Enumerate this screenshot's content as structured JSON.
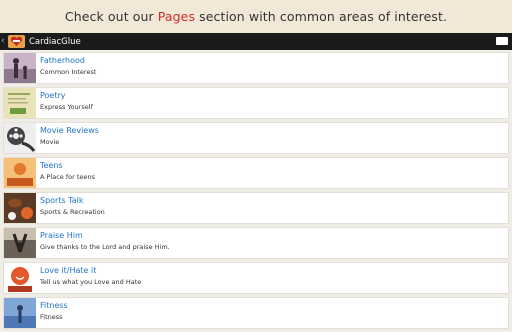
{
  "banner": {
    "pre": "Check out our",
    "highlight": "Pages",
    "post": "section with common areas of interest."
  },
  "app": {
    "title": "CardiacGlue",
    "back_icon": "back-chevron-icon",
    "logo_icon": "heart-logo-icon",
    "overflow_icon": "overflow-menu-icon"
  },
  "colors": {
    "banner_bg": "#f2e8d8",
    "highlight": "#d12d2d",
    "appbar_bg": "#1b1b1b",
    "link": "#2176c9"
  },
  "items": [
    {
      "title": "Fatherhood",
      "subtitle": "Common Interest",
      "icon": "fatherhood-thumbnail"
    },
    {
      "title": "Poetry",
      "subtitle": "Express Yourself",
      "icon": "poetry-thumbnail"
    },
    {
      "title": "Movie Reviews",
      "subtitle": "Movie",
      "icon": "film-reel-thumbnail"
    },
    {
      "title": "Teens",
      "subtitle": "A Place for teens",
      "icon": "teens-thumbnail"
    },
    {
      "title": "Sports Talk",
      "subtitle": "Sports & Recreation",
      "icon": "sports-thumbnail"
    },
    {
      "title": "Praise Him",
      "subtitle": "Give thanks to the Lord and praise Him.",
      "icon": "praise-thumbnail"
    },
    {
      "title": "Love it/Hate it",
      "subtitle": "Tell us what you Love and Hate",
      "icon": "love-hate-thumbnail"
    },
    {
      "title": "Fitness",
      "subtitle": "Fitness",
      "icon": "fitness-thumbnail"
    }
  ]
}
